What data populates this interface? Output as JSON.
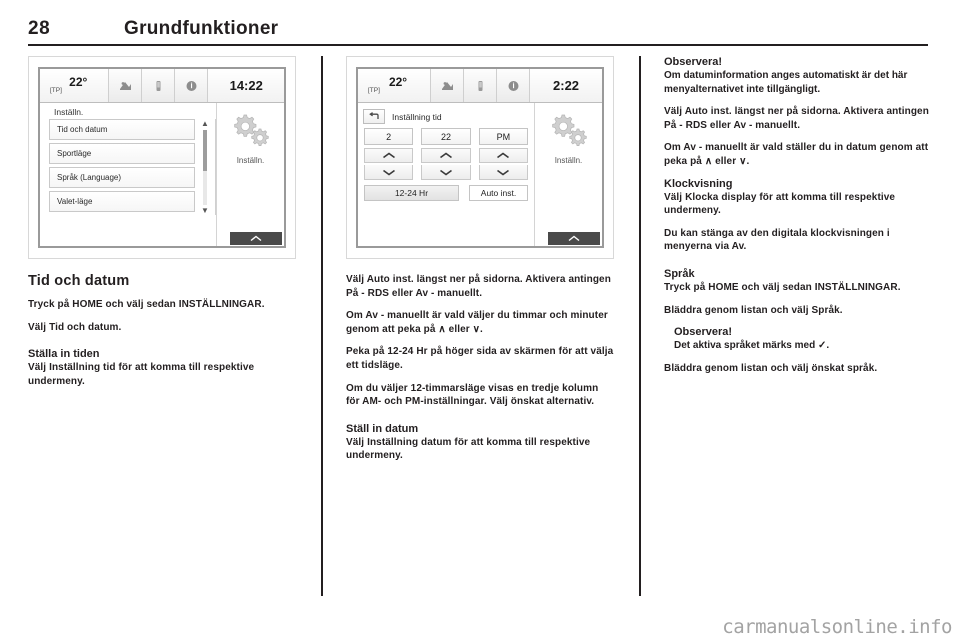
{
  "header": {
    "page_number": "28",
    "title": "Grundfunktioner"
  },
  "figure1": {
    "statusbar": {
      "temp": "22°",
      "tp": "[TP]",
      "clock": "14:22",
      "icons": [
        "media-icon",
        "phone-icon",
        "info-icon"
      ]
    },
    "list_title": "Inställn.",
    "items": [
      "Tid och datum",
      "Sportläge",
      "Språk (Language)",
      "Valet-läge"
    ],
    "side_label": "Inställn."
  },
  "figure2": {
    "statusbar": {
      "temp": "22°",
      "tp": "[TP]",
      "clock": "2:22",
      "icons": [
        "media-icon",
        "phone-icon",
        "info-icon"
      ]
    },
    "panel_title": "Inställning tid",
    "fields": [
      {
        "value": "2"
      },
      {
        "value": "22"
      },
      {
        "value": "PM"
      }
    ],
    "format_button": "12-24 Hr",
    "auto_button": "Auto inst.",
    "side_label": "Inställn."
  },
  "col1": {
    "heading": "Tid och datum",
    "p1": "Tryck på HOME och välj sedan INSTÄLLNINGAR.",
    "p2": "Välj Tid och datum.",
    "sub1": "Ställa in tiden",
    "p3": "Välj Inställning tid för att komma till respektive undermeny."
  },
  "col2": {
    "p1": "Välj Auto inst. längst ner på sidorna. Aktivera antingen På - RDS eller Av - manuellt.",
    "p2": "Om Av - manuellt är vald väljer du timmar och minuter genom att peka på ∧ eller ∨.",
    "p3": "Peka på 12-24 Hr på höger sida av skärmen för att välja ett tidsläge.",
    "p4": "Om du väljer 12-timmarsläge visas en tredje kolumn för AM- och PM-inställningar. Välj önskat alternativ.",
    "sub1": "Ställ in datum",
    "p5": "Välj Inställning datum för att komma till respektive undermeny."
  },
  "col3": {
    "note1_title": "Observera!",
    "note1_body": "Om datuminformation anges automatiskt är det här menyalternativet inte tillgängligt.",
    "p1": "Välj Auto inst. längst ner på sidorna. Aktivera antingen På - RDS eller Av - manuellt.",
    "p2": "Om Av - manuellt är vald ställer du in datum genom att peka på ∧ eller ∨.",
    "sub1": "Klockvisning",
    "p3": "Välj Klocka display för att komma till respektive undermeny.",
    "p4": "Du kan stänga av den digitala klockvisningen i menyerna via Av.",
    "sub2": "Språk",
    "p5": "Tryck på HOME och välj sedan INSTÄLLNINGAR.",
    "p6": "Bläddra genom listan och välj Språk.",
    "note2_title": "Observera!",
    "note2_body": "Det aktiva språket märks med ✓.",
    "p7": "Bläddra genom listan och välj önskat språk."
  },
  "watermark": "carmanualsonline.info",
  "colors": {
    "text": "#231f20",
    "device_border": "#9a9a9a",
    "watermark": "#a3a3a3"
  }
}
